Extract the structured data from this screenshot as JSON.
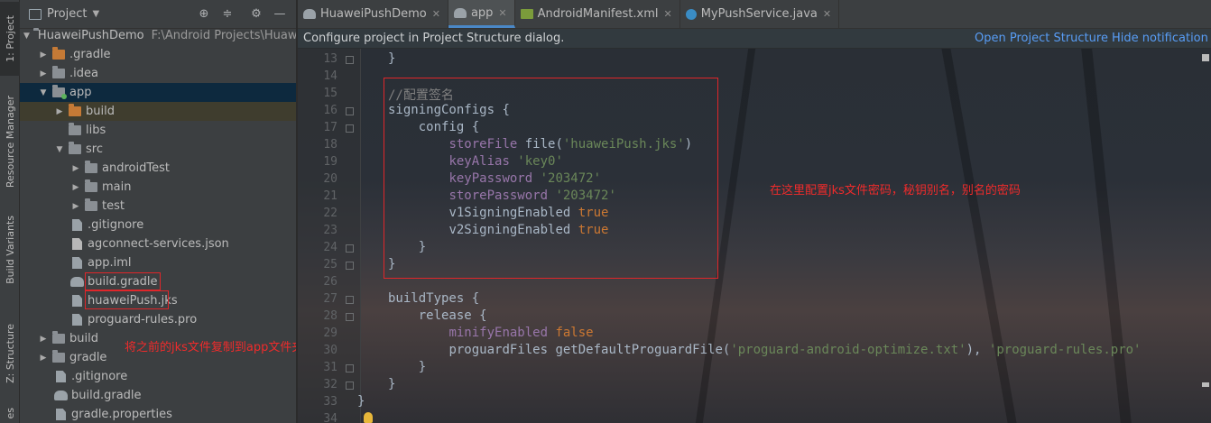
{
  "tool_strip": {
    "project_tab": "1: Project",
    "resource_tab": "Resource Manager",
    "variants_tab": "Build Variants",
    "structure_tab": "Z: Structure",
    "bottom_tab": "es"
  },
  "panel": {
    "title": "Project",
    "icons": [
      "target-icon",
      "collapse-icon",
      "settings-icon",
      "hide-icon"
    ]
  },
  "tree": [
    {
      "label": "HuaweiPushDemo",
      "path": "F:\\Android Projects\\Huaw"
    },
    {
      "label": ".gradle"
    },
    {
      "label": ".idea"
    },
    {
      "label": "app"
    },
    {
      "label": "build"
    },
    {
      "label": "libs"
    },
    {
      "label": "src"
    },
    {
      "label": "androidTest"
    },
    {
      "label": "main"
    },
    {
      "label": "test"
    },
    {
      "label": ".gitignore"
    },
    {
      "label": "agconnect-services.json"
    },
    {
      "label": "app.iml"
    },
    {
      "label": "build.gradle"
    },
    {
      "label": "huaweiPush.jks"
    },
    {
      "label": "proguard-rules.pro"
    },
    {
      "label": "build"
    },
    {
      "label": "gradle"
    },
    {
      "label": ".gitignore"
    },
    {
      "label": "build.gradle"
    },
    {
      "label": "gradle.properties"
    }
  ],
  "annotation_left": "将之前的jks文件复制到app文件夹下",
  "annotation_right": "在这里配置jks文件密码，秘钥别名，别名的密码",
  "tabs": [
    {
      "label": "HuaweiPushDemo",
      "icon": "gradle-icon"
    },
    {
      "label": "app",
      "icon": "gradle-icon",
      "active": true
    },
    {
      "label": "AndroidManifest.xml",
      "icon": "xml-icon"
    },
    {
      "label": "MyPushService.java",
      "icon": "java-class-icon"
    }
  ],
  "notification": {
    "message": "Configure project in Project Structure dialog.",
    "open_link": "Open Project Structure",
    "hide_link": "Hide notification"
  },
  "line_numbers": [
    "13",
    "14",
    "15",
    "16",
    "17",
    "18",
    "19",
    "20",
    "21",
    "22",
    "23",
    "24",
    "25",
    "26",
    "27",
    "28",
    "29",
    "30",
    "31",
    "32",
    "33",
    "34"
  ],
  "code": {
    "l13": "}",
    "l15": "//配置签名",
    "l16_a": "signingConfigs",
    "l16_b": " {",
    "l17": "config {",
    "l18_a": "storeFile",
    "l18_b": " file(",
    "l18_c": "'huaweiPush.jks'",
    "l18_d": ")",
    "l19_a": "keyAlias",
    "l19_b": " 'key0'",
    "l20_a": "keyPassword",
    "l20_b": " '203472'",
    "l21_a": "storePassword",
    "l21_b": " '203472'",
    "l22_a": "v1SigningEnabled",
    "l22_b": " true",
    "l23_a": "v2SigningEnabled",
    "l23_b": " true",
    "l24": "}",
    "l25": "}",
    "l27": "buildTypes {",
    "l28": "release {",
    "l29_a": "minifyEnabled",
    "l29_b": " false",
    "l30_a": "proguardFiles getDefaultProguardFile(",
    "l30_b": "'proguard-android-optimize.txt'",
    "l30_c": "), ",
    "l30_d": "'proguard-rules.pro'",
    "l31": "}",
    "l32": "}",
    "l33": "}"
  },
  "colors": {
    "annotation": "#f02b2b",
    "selection": "#0d293e",
    "link": "#589df6",
    "keyword": "#cc7832",
    "string": "#6a8759",
    "property": "#9876aa"
  }
}
